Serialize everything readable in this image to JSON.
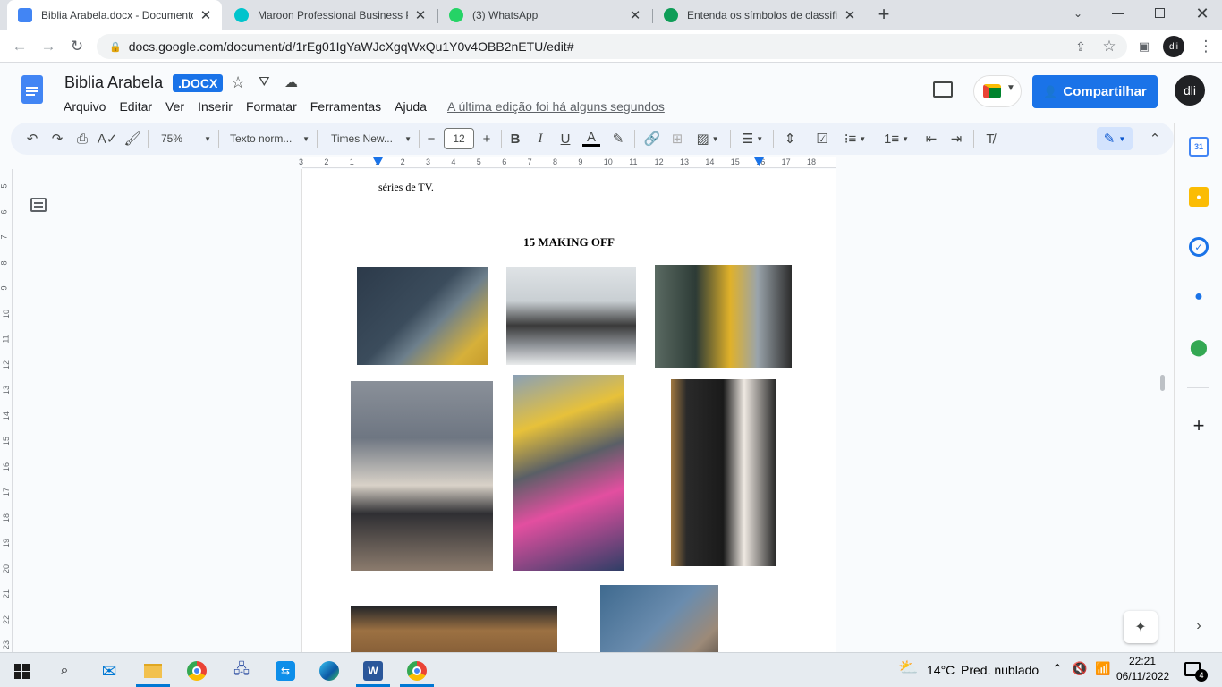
{
  "browser": {
    "tabs": [
      {
        "title": "Biblia Arabela.docx - Documento",
        "favicon_color": "#4285f4",
        "close": "✕",
        "active": true
      },
      {
        "title": "Maroon Professional Business Pa",
        "favicon_color": "#00c4cc",
        "close": "✕",
        "active": false
      },
      {
        "title": "(3) WhatsApp",
        "favicon_color": "#25d366",
        "close": "✕",
        "active": false
      },
      {
        "title": "Entenda os símbolos de classifica",
        "favicon_color": "#0f9d58",
        "close": "✕",
        "active": false
      }
    ],
    "new_tab": "+",
    "url": "docs.google.com/document/d/1rEg01IgYaWJcXgqWxQu1Y0v4OBB2nETU/edit#"
  },
  "docs": {
    "title": "Biblia Arabela",
    "badge": ".DOCX",
    "menu": [
      "Arquivo",
      "Editar",
      "Ver",
      "Inserir",
      "Formatar",
      "Ferramentas",
      "Ajuda"
    ],
    "last_edit": "A última edição foi há alguns segundos",
    "share_label": "Compartilhar",
    "avatar_text": "dli"
  },
  "toolbar": {
    "zoom": "75%",
    "style": "Texto norm...",
    "font": "Times New...",
    "font_size": "12"
  },
  "ruler": {
    "h_numbers": [
      "3",
      "2",
      "1",
      "1",
      "2",
      "3",
      "4",
      "5",
      "6",
      "7",
      "8",
      "9",
      "10",
      "11",
      "12",
      "13",
      "14",
      "15",
      "16",
      "17",
      "18"
    ],
    "v_numbers": [
      "5",
      "6",
      "7",
      "8",
      "9",
      "10",
      "11",
      "12",
      "13",
      "14",
      "15",
      "16",
      "17",
      "18",
      "19",
      "20",
      "21",
      "22",
      "23"
    ]
  },
  "document": {
    "text_line": "séries de TV.",
    "heading": "15 MAKING OFF",
    "photos": [
      {
        "name": "photo-filming",
        "colors": [
          "#2c3a4a",
          "#d6b03a"
        ]
      },
      {
        "name": "photo-office-group",
        "colors": [
          "#c9cfd3",
          "#3a3a3a"
        ]
      },
      {
        "name": "photo-hallway",
        "colors": [
          "#5a6a62",
          "#e0b12a"
        ]
      },
      {
        "name": "photo-group-pose",
        "colors": [
          "#6e7682",
          "#d9d2c8"
        ]
      },
      {
        "name": "photo-selfie",
        "colors": [
          "#8aa0b6",
          "#e34fa0"
        ]
      },
      {
        "name": "photo-actress-gloves",
        "colors": [
          "#2a2a2a",
          "#efe9e2"
        ]
      },
      {
        "name": "photo-bags",
        "colors": [
          "#1f2328",
          "#9c7142"
        ]
      },
      {
        "name": "photo-bedroom",
        "colors": [
          "#3f6a8f",
          "#9c8a78"
        ]
      }
    ]
  },
  "taskbar": {
    "weather_temp": "14°C",
    "weather_text": "Pred. nublado",
    "time": "22:21",
    "date": "06/11/2022",
    "notification_count": "4"
  }
}
